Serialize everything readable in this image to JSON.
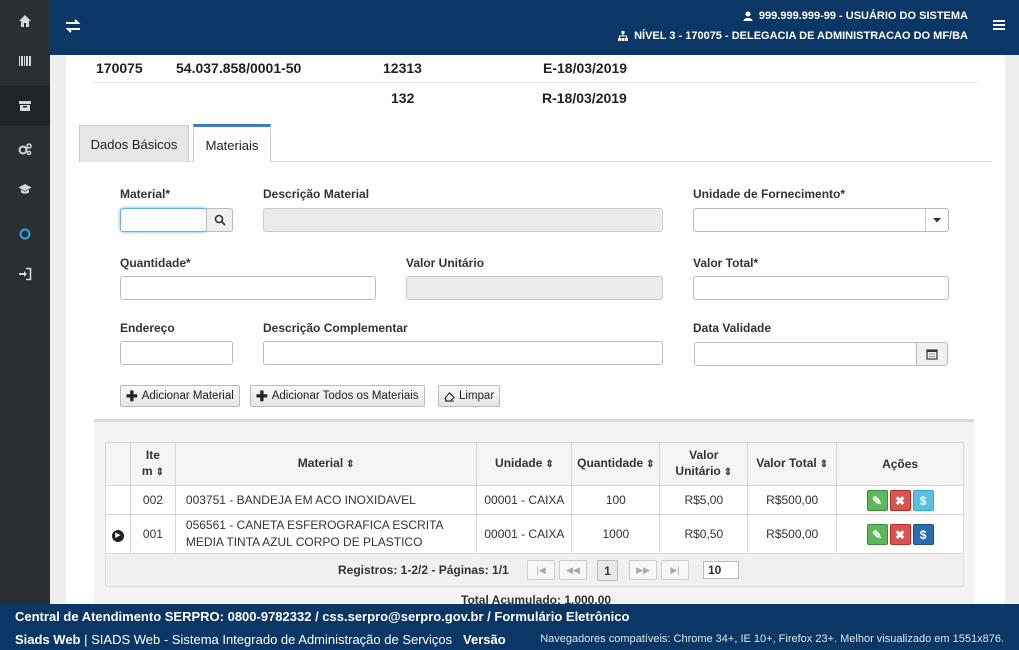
{
  "header": {
    "user": "999.999.999-99 - USUÁRIO DO SISTEMA",
    "level": "NÍVEL 3 - 170075 - DELEGACIA DE ADMINISTRACAO DO MF/BA"
  },
  "sidebar": {
    "items": [
      "home-icon",
      "barcode-icon",
      "archive-icon",
      "gears-icon",
      "graduation-icon",
      "circle-icon",
      "sign-in-icon"
    ]
  },
  "summary": {
    "row1": {
      "ug": "170075",
      "cnpj": "54.037.858/0001-50",
      "num": "12313",
      "date": "E-18/03/2019"
    },
    "row2": {
      "num": "132",
      "date": "R-18/03/2019"
    }
  },
  "tabs": [
    {
      "label": "Dados Básicos",
      "active": false
    },
    {
      "label": "Materiais",
      "active": true
    }
  ],
  "form": {
    "material_label": "Material*",
    "material_value": "",
    "descricao_label": "Descrição Material",
    "unidade_label": "Unidade de Fornecimento*",
    "quantidade_label": "Quantidade*",
    "valor_unit_label": "Valor Unitário",
    "valor_total_label": "Valor Total*",
    "endereco_label": "Endereço",
    "desc_compl_label": "Descrição Complementar",
    "data_validade_label": "Data Validade"
  },
  "buttons": {
    "add": "Adicionar Material",
    "add_all": "Adicionar Todos os Materiais",
    "clear": "Limpar"
  },
  "table": {
    "headers": {
      "item_line1": "Ite",
      "item_line2": "m",
      "material": "Material",
      "unidade": "Unidade",
      "quantidade": "Quantidade",
      "valor_unit_line1": "Valor",
      "valor_unit_line2": "Unitário",
      "valor_total": "Valor Total",
      "acoes": "Ações"
    },
    "rows": [
      {
        "item": "002",
        "material": "003751 - BANDEJA EM ACO INOXIDAVEL",
        "material2": "",
        "unidade": "00001 - CAIXA",
        "quantidade": "100",
        "valor_unit": "R$5,00",
        "valor_total": "R$500,00"
      },
      {
        "item": "001",
        "material": "056561 - CANETA ESFEROGRAFICA ESCRITA",
        "material2": "MEDIA TINTA AZUL CORPO DE PLASTICO",
        "unidade": "00001 - CAIXA",
        "quantidade": "1000",
        "valor_unit": "R$0,50",
        "valor_total": "R$500,00"
      }
    ]
  },
  "pager": {
    "text": "Registros: 1-2/2 - Páginas: 1/1",
    "current": "1",
    "page_size": "10"
  },
  "total": "Total Acumulado: 1.000,00",
  "footer": {
    "line1": "Central de Atendimento SERPRO: 0800-9782332 / css.serpro@serpro.gov.br / Formulário Eletrônico",
    "app": "Siads Web",
    "app_desc": "SIADS Web - Sistema Integrado de Administração de Serviços",
    "versao": "Versão",
    "browsers": "Navegadores compatíveis: Chrome 34+, IE 10+, Firefox 23+. Melhor visualizado em 1551x876."
  }
}
